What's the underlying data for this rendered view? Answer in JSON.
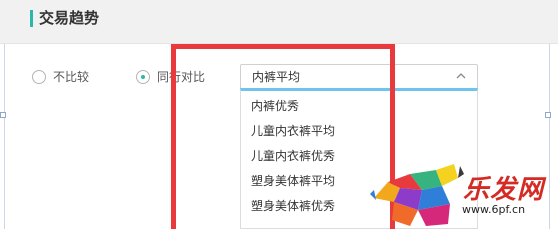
{
  "header": {
    "title": "交易趋势"
  },
  "compare": {
    "options": [
      {
        "label": "不比较",
        "selected": false
      },
      {
        "label": "同行对比",
        "selected": true
      }
    ]
  },
  "select": {
    "value": "内裤平均",
    "options": [
      "内裤优秀",
      "儿童内衣裤平均",
      "儿童内衣裤优秀",
      "塑身美体裤平均",
      "塑身美体裤优秀"
    ]
  },
  "watermark": {
    "brand": "乐发网",
    "url": "www.6pf.cn"
  },
  "colors": {
    "accent": "#2bb8aa",
    "highlight": "#e8393d",
    "dropdown_top": "#6ec4ea",
    "watermark": "#d42b24"
  }
}
